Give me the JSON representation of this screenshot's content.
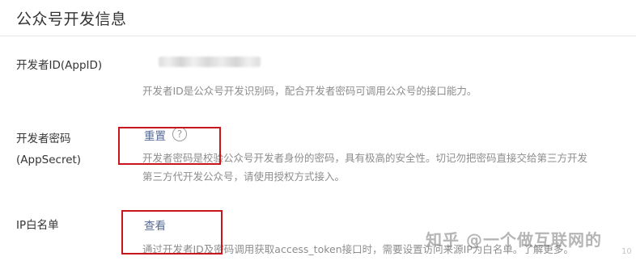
{
  "page": {
    "title": "公众号开发信息"
  },
  "rows": {
    "appid": {
      "label": "开发者ID(AppID)",
      "desc": "开发者ID是公众号开发识别码，配合开发者密码可调用公众号的接口能力。"
    },
    "secret": {
      "label_line1": "开发者密码",
      "label_line2": "(AppSecret)",
      "action": "重置",
      "help_symbol": "?",
      "desc_line1": "开发者密码是校验公众号开发者身份的密码，具有极高的安全性。切记勿把密码直接交给第三方开发",
      "desc_line2": "第三方代开发公众号，请使用授权方式接入。"
    },
    "ipwhitelist": {
      "label": "IP白名单",
      "action": "查看",
      "desc": "通过开发者ID及密码调用获取access_token接口时，需要设置访问来源IP为白名单。了解更多。"
    }
  },
  "watermark": {
    "text": "知乎 @一个做互联网的",
    "sub": "10"
  },
  "colors": {
    "highlight_box": "#c8161d",
    "link": "#576b95",
    "desc_text": "#8d8d8d"
  }
}
